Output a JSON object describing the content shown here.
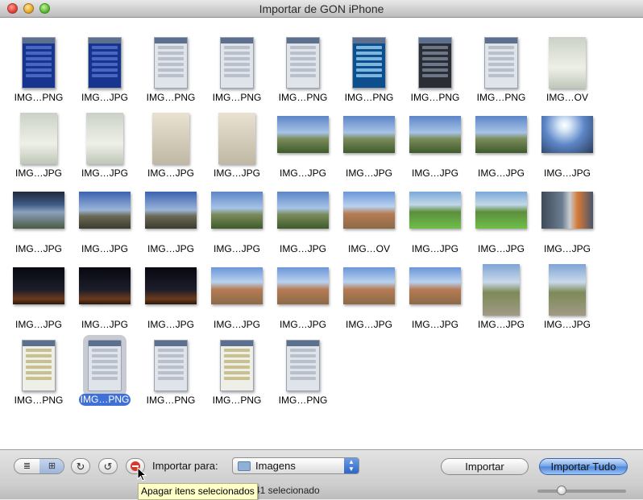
{
  "window": {
    "title": "Importar de GON iPhone"
  },
  "items": [
    {
      "caption": "IMG…PNG",
      "kind": "phone",
      "style": "blue"
    },
    {
      "caption": "IMG…JPG",
      "kind": "phone",
      "style": "blue"
    },
    {
      "caption": "IMG…PNG",
      "kind": "phone",
      "style": ""
    },
    {
      "caption": "IMG…PNG",
      "kind": "phone",
      "style": ""
    },
    {
      "caption": "IMG…PNG",
      "kind": "phone",
      "style": ""
    },
    {
      "caption": "IMG…PNG",
      "kind": "phone",
      "style": "grid"
    },
    {
      "caption": "IMG…PNG",
      "kind": "phone",
      "style": "dark"
    },
    {
      "caption": "IMG…PNG",
      "kind": "phone",
      "style": ""
    },
    {
      "caption": "IMG…OV",
      "kind": "port",
      "style": "p-doc"
    },
    {
      "caption": "IMG…JPG",
      "kind": "port",
      "style": "p-doc"
    },
    {
      "caption": "IMG…JPG",
      "kind": "port",
      "style": "p-doc"
    },
    {
      "caption": "IMG…JPG",
      "kind": "port",
      "style": "p-dev"
    },
    {
      "caption": "IMG…JPG",
      "kind": "port",
      "style": "p-dev"
    },
    {
      "caption": "IMG…JPG",
      "kind": "land",
      "style": "p-sky"
    },
    {
      "caption": "IMG…JPG",
      "kind": "land",
      "style": "p-sky"
    },
    {
      "caption": "IMG…JPG",
      "kind": "land",
      "style": "p-sky"
    },
    {
      "caption": "IMG…JPG",
      "kind": "land",
      "style": "p-sky"
    },
    {
      "caption": "IMG…JPG",
      "kind": "land",
      "style": "p-sun"
    },
    {
      "caption": "IMG…JPG",
      "kind": "land",
      "style": "p-hill"
    },
    {
      "caption": "IMG…JPG",
      "kind": "land",
      "style": "p-eve"
    },
    {
      "caption": "IMG…JPG",
      "kind": "land",
      "style": "p-eve"
    },
    {
      "caption": "IMG…JPG",
      "kind": "land",
      "style": "p-sky"
    },
    {
      "caption": "IMG…JPG",
      "kind": "land",
      "style": "p-sky"
    },
    {
      "caption": "IMG…OV",
      "kind": "land",
      "style": "p-build"
    },
    {
      "caption": "IMG…JPG",
      "kind": "land",
      "style": "p-lawn"
    },
    {
      "caption": "IMG…JPG",
      "kind": "land",
      "style": "p-lawn"
    },
    {
      "caption": "IMG…JPG",
      "kind": "land",
      "style": "p-door"
    },
    {
      "caption": "IMG…JPG",
      "kind": "land",
      "style": "p-night"
    },
    {
      "caption": "IMG…JPG",
      "kind": "land",
      "style": "p-night"
    },
    {
      "caption": "IMG…JPG",
      "kind": "land",
      "style": "p-night"
    },
    {
      "caption": "IMG…JPG",
      "kind": "land",
      "style": "p-build"
    },
    {
      "caption": "IMG…JPG",
      "kind": "land",
      "style": "p-build"
    },
    {
      "caption": "IMG…JPG",
      "kind": "land",
      "style": "p-build"
    },
    {
      "caption": "IMG…JPG",
      "kind": "land",
      "style": "p-build"
    },
    {
      "caption": "IMG…JPG",
      "kind": "port",
      "style": "p-road"
    },
    {
      "caption": "IMG…JPG",
      "kind": "port",
      "style": "p-road"
    },
    {
      "caption": "IMG…PNG",
      "kind": "phone",
      "style": "map"
    },
    {
      "caption": "IMG…PNG",
      "kind": "phone",
      "style": "",
      "selected": true
    },
    {
      "caption": "IMG…PNG",
      "kind": "phone",
      "style": ""
    },
    {
      "caption": "IMG…PNG",
      "kind": "phone",
      "style": "map"
    },
    {
      "caption": "IMG…PNG",
      "kind": "phone",
      "style": ""
    }
  ],
  "toolbar": {
    "view_list_glyph": "≣",
    "view_grid_glyph": "⊞",
    "rotate_right_glyph": "↻",
    "rotate_left_glyph": "↺",
    "import_to_label": "Importar para:",
    "destination_value": "Imagens",
    "import_button": "Importar",
    "import_all_button": "Importar Tudo"
  },
  "status": {
    "selection_text": "41 selecionado",
    "tooltip": "Apagar itens selecionados",
    "thumbnail_size": 0.22
  },
  "icons": {
    "delete": "delete-icon",
    "folder": "folder-icon",
    "cursor": "arrow-cursor-icon"
  }
}
